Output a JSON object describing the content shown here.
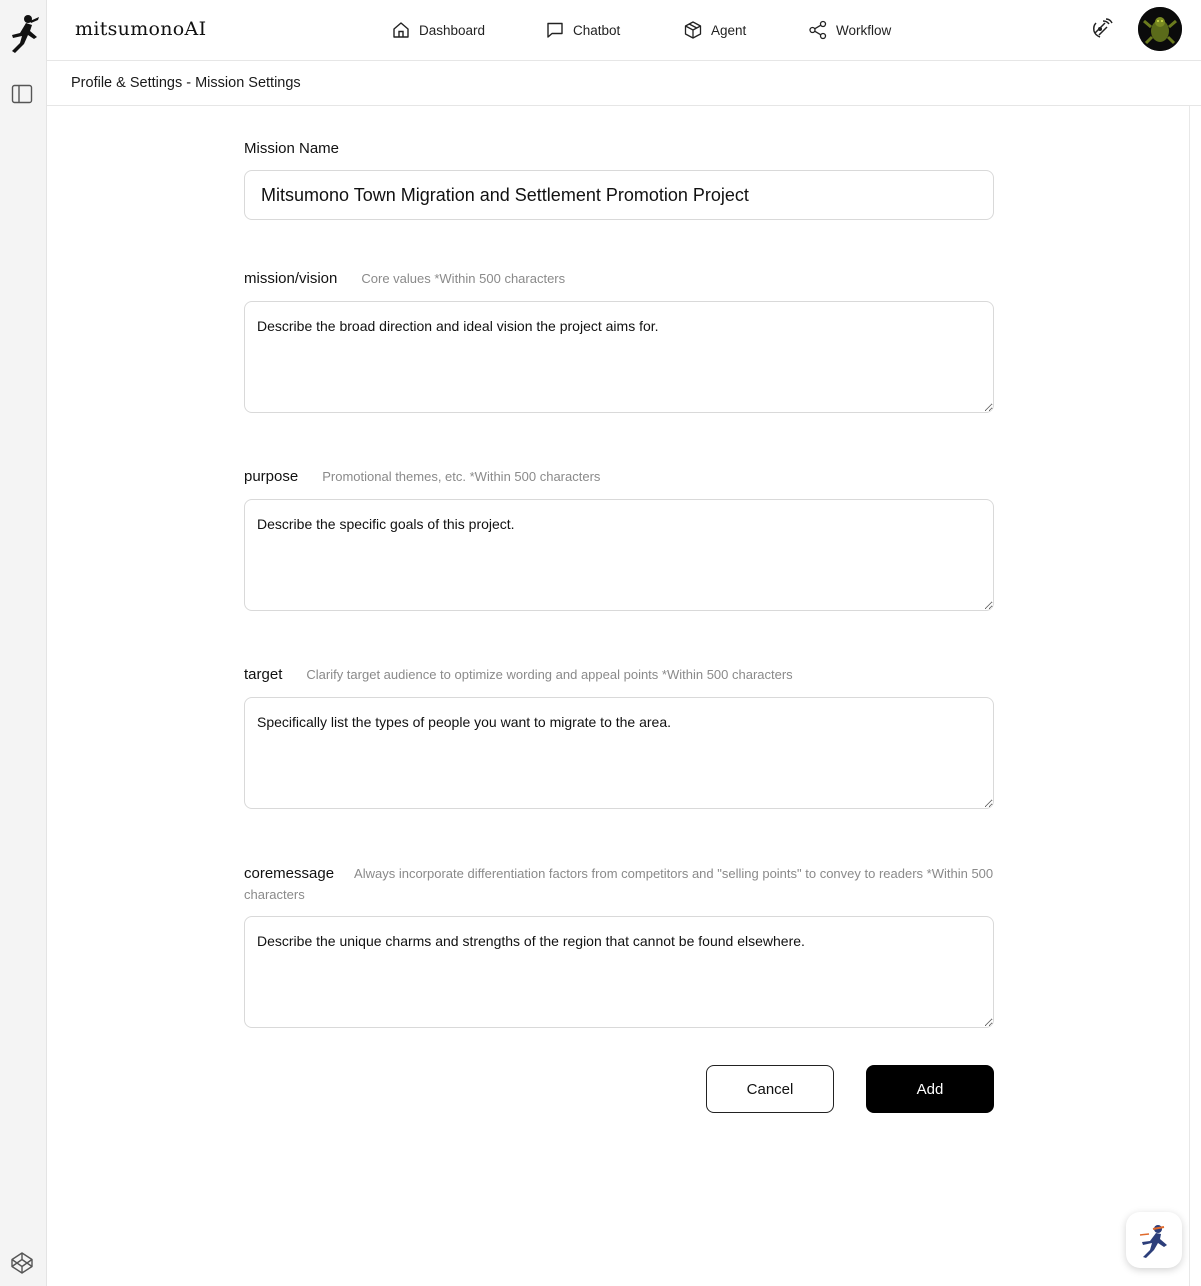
{
  "app": {
    "brand": "mitsumonoAI"
  },
  "nav": {
    "dashboard": "Dashboard",
    "chatbot": "Chatbot",
    "agent": "Agent",
    "workflow": "Workflow"
  },
  "breadcrumb": "Profile & Settings - Mission Settings",
  "form": {
    "mission_name": {
      "label": "Mission Name",
      "value": "Mitsumono Town Migration and Settlement Promotion Project"
    },
    "mission_vision": {
      "label": "mission/vision",
      "hint": "Core values *Within 500 characters",
      "placeholder": "Describe the broad direction and ideal vision the project aims for."
    },
    "purpose": {
      "label": "purpose",
      "hint": "Promotional themes, etc. *Within 500 characters",
      "placeholder": "Describe the specific goals of this project."
    },
    "target": {
      "label": "target",
      "hint": "Clarify target audience to optimize wording and appeal points *Within 500 characters",
      "placeholder": "Specifically list the types of people you want to migrate to the area."
    },
    "coremessage": {
      "label": "coremessage",
      "hint": "Always incorporate differentiation factors from competitors and \"selling points\" to convey to readers *Within 500 characters",
      "placeholder": "Describe the unique charms and strengths of the region that cannot be found elsewhere."
    }
  },
  "actions": {
    "cancel": "Cancel",
    "add": "Add"
  },
  "icons": {
    "logo": "running-ninja-logo-icon",
    "sidebar_toggle": "sidebar-toggle-icon",
    "dashboard": "home-icon",
    "chatbot": "chat-bubble-icon",
    "agent": "cube-icon",
    "workflow": "share-nodes-icon",
    "signal": "signal-icon",
    "codepen": "codepen-icon",
    "helper": "ninja-helper-icon"
  },
  "colors": {
    "primary_button": "#000000",
    "hint_text": "#8a8a8a",
    "sidebar_bg": "#f4f4f4"
  }
}
